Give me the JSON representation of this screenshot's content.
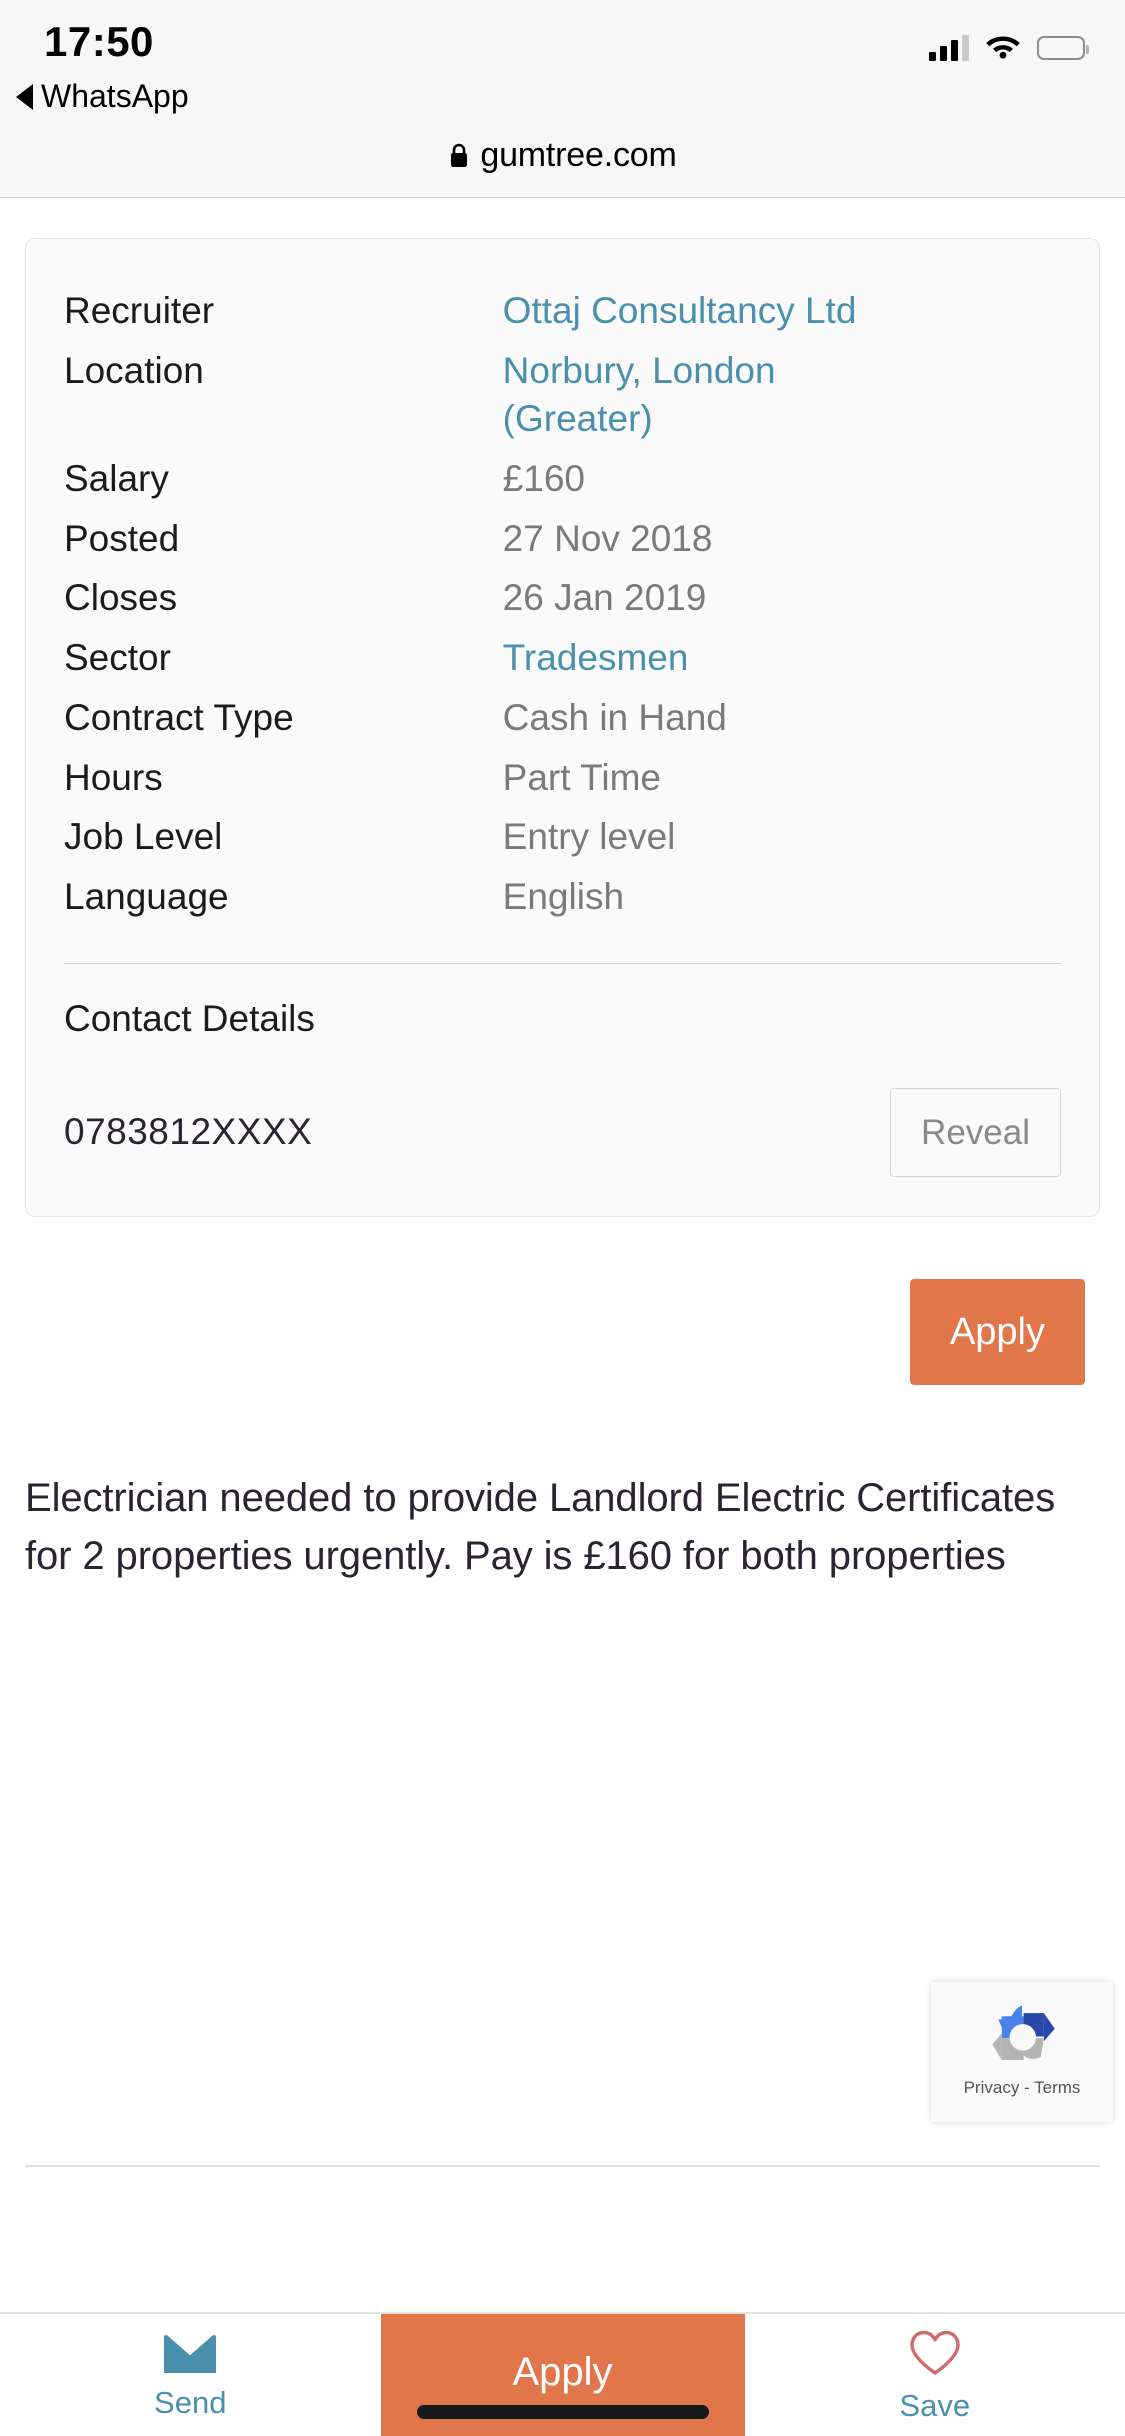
{
  "status_bar": {
    "time": "17:50",
    "back_app": "WhatsApp",
    "back_icon": "triangle-left-icon",
    "signal_icon": "cellular-signal-icon",
    "wifi_icon": "wifi-icon",
    "battery_icon": "battery-low-icon"
  },
  "browser": {
    "lock_icon": "lock-icon",
    "url": "gumtree.com"
  },
  "details": {
    "rows": [
      {
        "label": "Recruiter",
        "value": "Ottaj Consultancy Ltd",
        "link": true
      },
      {
        "label": "Location",
        "value": "Norbury, London",
        "value_line2": "(Greater)",
        "link": true
      },
      {
        "label": "Salary",
        "value": "£160",
        "link": false
      },
      {
        "label": "Posted",
        "value": "27 Nov 2018",
        "link": false
      },
      {
        "label": "Closes",
        "value": "26 Jan 2019",
        "link": false
      },
      {
        "label": "Sector",
        "value": "Tradesmen",
        "link": true
      },
      {
        "label": "Contract Type",
        "value": "Cash in Hand",
        "link": false
      },
      {
        "label": "Hours",
        "value": "Part Time",
        "link": false
      },
      {
        "label": "Job Level",
        "value": "Entry level",
        "link": false
      },
      {
        "label": "Language",
        "value": "English",
        "link": false
      }
    ],
    "contact_title": "Contact Details",
    "contact_phone": "0783812XXXX",
    "reveal_label": "Reveal"
  },
  "apply": {
    "top_label": "Apply"
  },
  "description": {
    "text": "Electrician needed to provide Landlord Electric Certificates for 2 properties urgently. Pay is £160 for both properties"
  },
  "recaptcha": {
    "logo_icon": "recaptcha-logo-icon",
    "text": "Privacy - Terms"
  },
  "tabbar": {
    "send_label": "Send",
    "send_icon": "envelope-icon",
    "apply_label": "Apply",
    "save_label": "Save",
    "save_icon": "heart-outline-icon"
  },
  "colors": {
    "accent_orange": "#e2764b",
    "link_blue": "#4a90ad",
    "heart_red": "#cf6b6b",
    "value_gray": "#7a7a7a"
  }
}
